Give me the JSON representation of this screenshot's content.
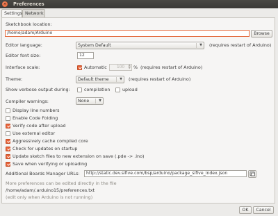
{
  "window": {
    "title": "Preferences"
  },
  "tabs": [
    {
      "label": "Settings",
      "active": true
    },
    {
      "label": "Network",
      "active": false
    }
  ],
  "sketchbook": {
    "label": "Sketchbook location:",
    "value": "/home/adam/Arduino",
    "browse_label": "Browse"
  },
  "editor_language": {
    "label": "Editor language:",
    "value": "System Default",
    "note": "(requires restart of Arduino)"
  },
  "editor_font_size": {
    "label": "Editor font size:",
    "value": "12"
  },
  "interface_scale": {
    "label": "Interface scale:",
    "automatic_label": "Automatic",
    "automatic_checked": true,
    "value": "100",
    "unit": "%",
    "note": "(requires restart of Arduino)"
  },
  "theme": {
    "label": "Theme:",
    "value": "Default theme",
    "note": "(requires restart of Arduino)"
  },
  "verbose": {
    "label": "Show verbose output during:",
    "compilation_label": "compilation",
    "compilation_checked": false,
    "upload_label": "upload",
    "upload_checked": false
  },
  "compiler_warnings": {
    "label": "Compiler warnings:",
    "value": "None"
  },
  "options": [
    {
      "label": "Display line numbers",
      "checked": false
    },
    {
      "label": "Enable Code Folding",
      "checked": false
    },
    {
      "label": "Verify code after upload",
      "checked": true
    },
    {
      "label": "Use external editor",
      "checked": false
    },
    {
      "label": "Aggressively cache compiled core",
      "checked": true
    },
    {
      "label": "Check for updates on startup",
      "checked": true
    },
    {
      "label": "Update sketch files to new extension on save (.pde -> .ino)",
      "checked": true
    },
    {
      "label": "Save when verifying or uploading",
      "checked": true
    }
  ],
  "boards_manager": {
    "label": "Additional Boards Manager URLs:",
    "value": "http://static.dev.sifive.com/bsp/arduino/package_sifive_index.json"
  },
  "footer_notes": {
    "line1": "More preferences can be edited directly in the file",
    "path": "/home/adam/.arduino15/preferences.txt",
    "line3": "(edit only when Arduino is not running)"
  },
  "buttons": {
    "ok": "OK",
    "cancel": "Cancel"
  },
  "colors": {
    "accent": "#e8643a",
    "titlebar": "#3b3a37",
    "panel": "#f6f5f4"
  },
  "icons": {
    "close": "close-icon",
    "window_list": "window-list-icon",
    "dropdown": "chevron-down-icon"
  }
}
